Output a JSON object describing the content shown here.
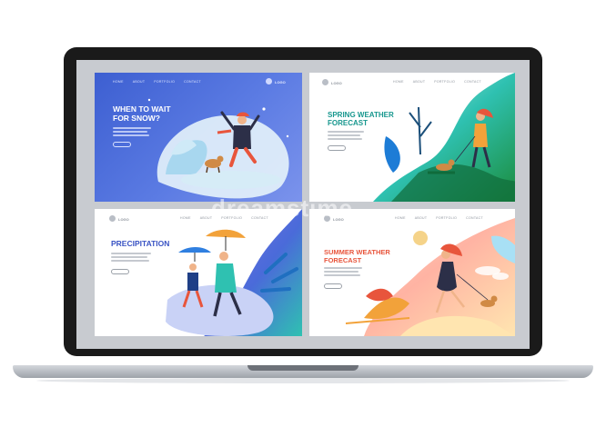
{
  "colors": {
    "panel1_bg": "#4a6bd9",
    "accent_teal": "#1fb7a8",
    "accent_green": "#4caf50",
    "accent_orange": "#f2a23a",
    "text_blue": "#3a54c4",
    "text_orange": "#e8553c",
    "text_teal": "#17978e"
  },
  "panels": [
    {
      "nav": [
        "HOME",
        "ABOUT",
        "PORTFOLIO",
        "CONTACT"
      ],
      "logo": "LOGO",
      "headline": "WHEN TO WAIT\nFOR SNOW?"
    },
    {
      "nav": [
        "HOME",
        "ABOUT",
        "PORTFOLIO",
        "CONTACT"
      ],
      "logo": "LOGO",
      "headline": "SPRING WEATHER\nFORECAST"
    },
    {
      "nav": [
        "HOME",
        "ABOUT",
        "PORTFOLIO",
        "CONTACT"
      ],
      "logo": "LOGO",
      "headline": "PRECIPITATION"
    },
    {
      "nav": [
        "HOME",
        "ABOUT",
        "PORTFOLIO",
        "CONTACT"
      ],
      "logo": "LOGO",
      "headline": "SUMMER WEATHER\nFORECAST"
    }
  ],
  "watermark": "dreamstime"
}
